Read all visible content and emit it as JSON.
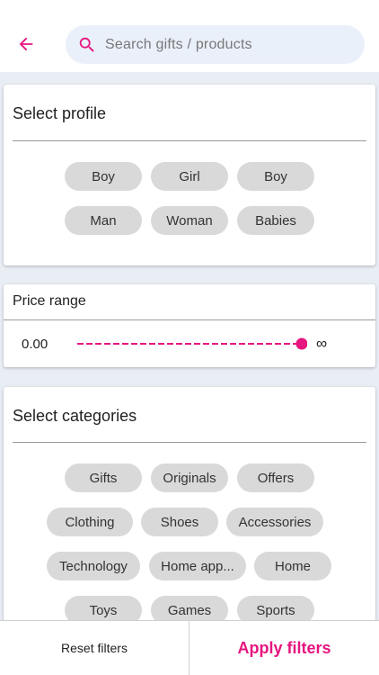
{
  "header": {
    "search_placeholder": "Search gifts / products"
  },
  "profile": {
    "title": "Select profile",
    "chips": [
      "Boy",
      "Girl",
      "Boy",
      "Man",
      "Woman",
      "Babies"
    ]
  },
  "price": {
    "title": "Price range",
    "min_label": "0.00",
    "max_label": "∞",
    "slider_value_fraction": 1.0
  },
  "categories": {
    "title": "Select categories",
    "chips": [
      "Gifts",
      "Originals",
      "Offers",
      "Clothing",
      "Shoes",
      "Accessories",
      "Technology",
      "Home app...",
      "Home",
      "Toys",
      "Games",
      "Sports"
    ]
  },
  "footer": {
    "reset_label": "Reset filters",
    "apply_label": "Apply filters"
  },
  "colors": {
    "accent": "#e6157f",
    "chip_bg": "#d9d9d9",
    "page_bg": "#e9edf4",
    "search_bg": "#eaf0fa"
  },
  "icons": {
    "back": "arrow-left-icon",
    "search": "search-icon"
  }
}
